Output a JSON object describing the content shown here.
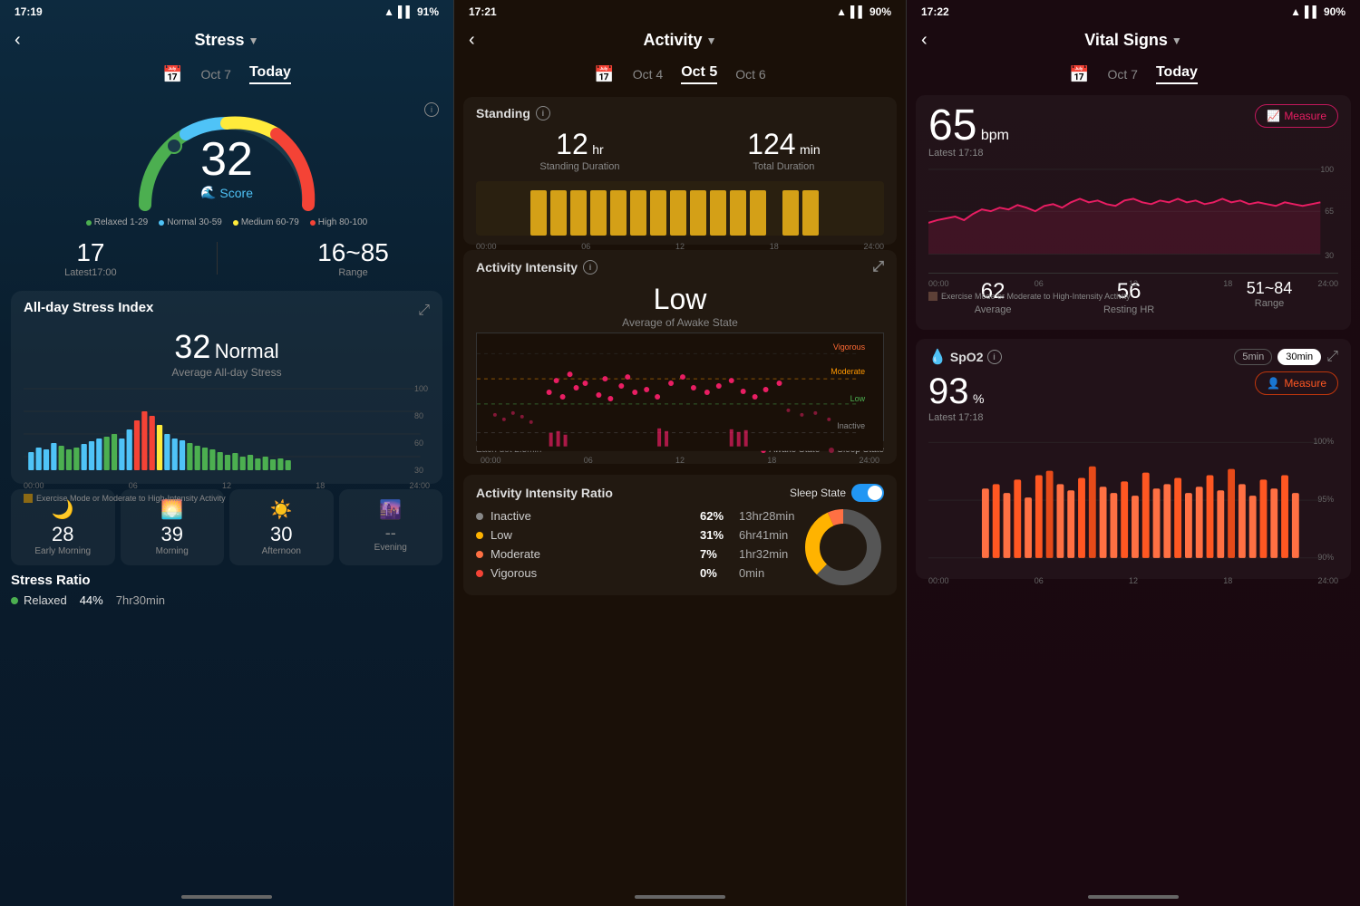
{
  "panel1": {
    "statusBar": {
      "time": "17:19",
      "battery": "91%"
    },
    "nav": {
      "title": "Stress",
      "backLabel": "‹"
    },
    "date": {
      "prev": "Oct 7",
      "current": "Today"
    },
    "gauge": {
      "score": "32",
      "label": "Score"
    },
    "legend": [
      {
        "label": "Relaxed 1-29",
        "color": "#4caf50"
      },
      {
        "label": "Normal 30-59",
        "color": "#4fc3f7"
      },
      {
        "label": "Medium 60-79",
        "color": "#ffeb3b"
      },
      {
        "label": "High 80-100",
        "color": "#f44336"
      }
    ],
    "stats": {
      "latest": "17",
      "latestLabel": "Latest17:00",
      "range": "16~85",
      "rangeLabel": "Range"
    },
    "allDayStress": {
      "title": "All-day Stress Index",
      "value": "32",
      "level": "Normal",
      "sublabel": "Average All-day Stress"
    },
    "chartXLabels": [
      "00:00",
      "06",
      "12",
      "18",
      "24:00"
    ],
    "chartYLabels": [
      "100",
      "80",
      "60",
      "30"
    ],
    "chartLegend": "Exercise Mode or Moderate to High-Intensity Activity",
    "timeBlocks": [
      {
        "icon": "🌙",
        "number": "28",
        "label": "Early Morning"
      },
      {
        "icon": "🌅",
        "number": "39",
        "label": "Morning"
      },
      {
        "icon": "☀️",
        "number": "30",
        "label": "Afternoon"
      },
      {
        "icon": "🌆",
        "number": "--",
        "label": "Evening"
      }
    ],
    "stressRatio": {
      "title": "Stress Ratio",
      "items": [
        {
          "label": "Relaxed",
          "pct": "44%",
          "time": "7hr30min",
          "color": "#4caf50"
        }
      ]
    }
  },
  "panel2": {
    "statusBar": {
      "time": "17:21",
      "battery": "90%"
    },
    "nav": {
      "title": "Activity",
      "backLabel": "‹"
    },
    "date": {
      "prev": "Oct 4",
      "current": "Oct 5",
      "next": "Oct 6"
    },
    "standing": {
      "title": "Standing",
      "durationValue": "12",
      "durationUnit": "hr",
      "durationLabel": "Standing Duration",
      "totalValue": "124",
      "totalUnit": "min",
      "totalLabel": "Total Duration"
    },
    "chartXLabels": [
      "00:00",
      "06",
      "12",
      "18",
      "24:00"
    ],
    "activityIntensity": {
      "title": "Activity Intensity",
      "level": "Low",
      "sublabel": "Average of Awake State",
      "yLabels": [
        "Vigorous",
        "Moderate",
        "Low",
        "Inactive"
      ],
      "dotLegend": "Each dot 2.5min",
      "awakeLegend": "Awake State",
      "sleepLegend": "Sleep State"
    },
    "intensityRatio": {
      "title": "Activity Intensity Ratio",
      "sleepState": "Sleep State",
      "items": [
        {
          "label": "Inactive",
          "pct": "62%",
          "time": "13hr28min",
          "color": "#888"
        },
        {
          "label": "Low",
          "pct": "31%",
          "time": "6hr41min",
          "color": "#ffb300"
        },
        {
          "label": "Moderate",
          "pct": "7%",
          "time": "1hr32min",
          "color": "#ff7043"
        },
        {
          "label": "Vigorous",
          "pct": "0%",
          "time": "0min",
          "color": "#f44336"
        }
      ]
    }
  },
  "panel3": {
    "statusBar": {
      "time": "17:22",
      "battery": "90%"
    },
    "nav": {
      "title": "Vital Signs",
      "backLabel": "‹"
    },
    "date": {
      "prev": "Oct 7",
      "current": "Today"
    },
    "heartRate": {
      "value": "65",
      "unit": "bpm",
      "latest": "Latest 17:18",
      "measureLabel": "Measure",
      "chartYLabels": [
        "100",
        "65",
        "30"
      ],
      "chartXLabels": [
        "00:00",
        "06",
        "12",
        "18",
        "24:00"
      ],
      "chartLegend": "Exercise Mode or Moderate to High-Intensity Activity",
      "stats": [
        {
          "value": "62",
          "label": "Average"
        },
        {
          "value": "56",
          "label": "Resting HR"
        },
        {
          "value": "51~84",
          "label": "Range"
        }
      ]
    },
    "spo2": {
      "title": "SpO2",
      "timeOptions": [
        "5min",
        "30min"
      ],
      "activeTime": "30min",
      "value": "93",
      "unit": "%",
      "latest": "Latest 17:18",
      "measureLabel": "Measure",
      "chartYLabels": [
        "100%",
        "95%",
        "90%"
      ],
      "chartXLabels": [
        "00:00",
        "06",
        "12",
        "18",
        "24:00"
      ]
    }
  }
}
